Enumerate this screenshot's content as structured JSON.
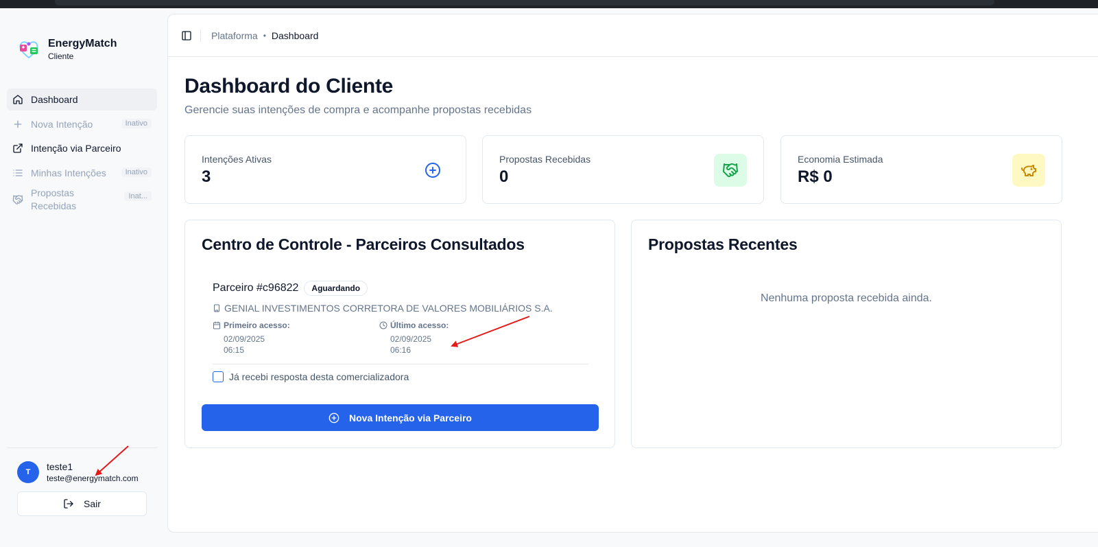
{
  "brand": {
    "name": "EnergyMatch",
    "role": "Cliente",
    "logo_icon": "energymatch-logo"
  },
  "sidebar": {
    "items": [
      {
        "label": "Dashboard",
        "icon": "home-icon",
        "active": true,
        "badge": ""
      },
      {
        "label": "Nova Intenção",
        "icon": "plus-icon",
        "badge": "Inativo"
      },
      {
        "label": "Intenção via Parceiro",
        "icon": "external-link-icon",
        "badge": ""
      },
      {
        "label": "Minhas Intenções",
        "icon": "list-icon",
        "badge": "Inativo"
      },
      {
        "label": "Propostas Recebidas",
        "icon": "handshake-icon",
        "badge": "Inat..."
      }
    ]
  },
  "user": {
    "initial": "T",
    "name": "teste1",
    "email": "teste@energymatch.com",
    "logout_label": "Sair"
  },
  "header": {
    "breadcrumb_root": "Plataforma",
    "breadcrumb_sep": "•",
    "breadcrumb_current": "Dashboard"
  },
  "page": {
    "title": "Dashboard do Cliente",
    "subtitle": "Gerencie suas intenções de compra e acompanhe propostas recebidas"
  },
  "stats": [
    {
      "label": "Intenções Ativas",
      "value": "3",
      "icon": "plus-circle-icon",
      "color": "#2563eb"
    },
    {
      "label": "Propostas Recebidas",
      "value": "0",
      "icon": "handshake-icon",
      "color": "#16a34a"
    },
    {
      "label": "Economia Estimada",
      "value": "R$ 0",
      "icon": "piggy-bank-icon",
      "color": "#ca8a04"
    }
  ],
  "control_center": {
    "title": "Centro de Controle - Parceiros Consultados",
    "partner": {
      "title": "Parceiro #c96822",
      "status": "Aguardando",
      "company": "GENIAL INVESTIMENTOS CORRETORA DE VALORES MOBILIÁRIOS S.A.",
      "first_access_label": "Primeiro acesso:",
      "first_access_value": "02/09/2025 06:15",
      "last_access_label": "Último acesso:",
      "last_access_value": "02/09/2025 06:16",
      "checkbox_label": "Já recebi resposta desta comercializadora",
      "checkbox_checked": false
    },
    "cta_label": "Nova Intenção via Parceiro"
  },
  "recent": {
    "title": "Propostas Recentes",
    "empty_text": "Nenhuma proposta recebida ainda."
  },
  "colors": {
    "primary": "#2563eb",
    "annotation_arrow": "#e31b1b"
  }
}
